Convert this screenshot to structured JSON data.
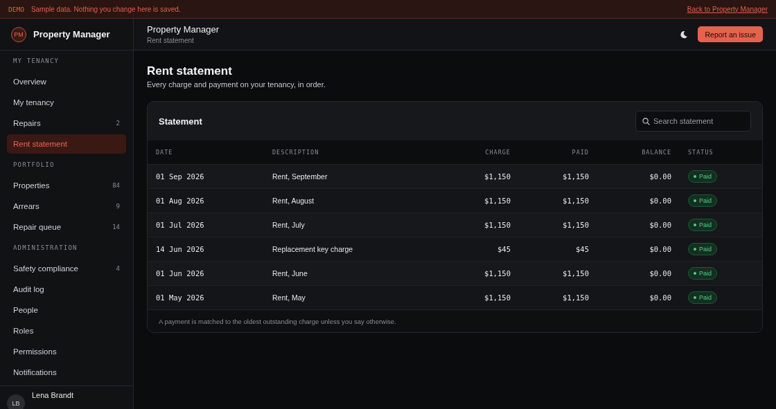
{
  "banner": {
    "tag": "DEMO",
    "message": "Sample data. Nothing you change here is saved.",
    "link": "Back to Property Manager"
  },
  "sidebar": {
    "logo": "PM",
    "title": "Property Manager",
    "sections": [
      {
        "label": "MY TENANCY",
        "items": [
          {
            "label": "Overview",
            "selected": false
          },
          {
            "label": "My tenancy",
            "selected": false
          },
          {
            "label": "Repairs",
            "count": "2",
            "selected": false
          },
          {
            "label": "Rent statement",
            "selected": true
          }
        ]
      },
      {
        "label": "PORTFOLIO",
        "items": [
          {
            "label": "Properties",
            "count": "84",
            "selected": false
          },
          {
            "label": "Arrears",
            "count": "9",
            "selected": false
          },
          {
            "label": "Repair queue",
            "count": "14",
            "selected": false
          }
        ]
      },
      {
        "label": "ADMINISTRATION",
        "items": [
          {
            "label": "Safety compliance",
            "count": "4",
            "selected": false
          },
          {
            "label": "Audit log",
            "selected": false
          },
          {
            "label": "People",
            "selected": false
          },
          {
            "label": "Roles",
            "selected": false
          },
          {
            "label": "Permissions",
            "selected": false
          },
          {
            "label": "Notifications",
            "selected": false
          }
        ]
      }
    ],
    "user": {
      "initials": "LB",
      "name": "Lena Brandt"
    }
  },
  "header": {
    "title": "Property Manager",
    "subtitle": "Rent statement",
    "button": "Report an issue"
  },
  "page": {
    "title": "Rent statement",
    "subtitle": "Every charge and payment on your tenancy, in order."
  },
  "statement": {
    "title": "Statement",
    "search": {
      "placeholder": "Search statement"
    },
    "columns": [
      "DATE",
      "DESCRIPTION",
      "CHARGE",
      "PAID",
      "BALANCE",
      "STATUS"
    ],
    "rows": [
      {
        "date": "01 Sep 2026",
        "description": "Rent, September",
        "charge": "$1,150",
        "paid": "$1,150",
        "balance": "$0.00",
        "status": {
          "label": "Paid",
          "kind": "paid"
        }
      },
      {
        "date": "01 Aug 2026",
        "description": "Rent, August",
        "charge": "$1,150",
        "paid": "$1,150",
        "balance": "$0.00",
        "status": {
          "label": "Paid",
          "kind": "paid"
        }
      },
      {
        "date": "01 Jul 2026",
        "description": "Rent, July",
        "charge": "$1,150",
        "paid": "$1,150",
        "balance": "$0.00",
        "status": {
          "label": "Paid",
          "kind": "paid"
        }
      },
      {
        "date": "14 Jun 2026",
        "description": "Replacement key charge",
        "charge": "$45",
        "paid": "$45",
        "balance": "$0.00",
        "status": {
          "label": "Paid",
          "kind": "paid"
        }
      },
      {
        "date": "01 Jun 2026",
        "description": "Rent, June",
        "charge": "$1,150",
        "paid": "$1,150",
        "balance": "$0.00",
        "status": {
          "label": "Paid",
          "kind": "paid"
        }
      },
      {
        "date": "01 May 2026",
        "description": "Rent, May",
        "charge": "$1,150",
        "paid": "$1,150",
        "balance": "$0.00",
        "status": {
          "label": "Paid",
          "kind": "paid"
        }
      }
    ],
    "note": "A payment is matched to the oldest outstanding charge unless you say otherwise."
  }
}
